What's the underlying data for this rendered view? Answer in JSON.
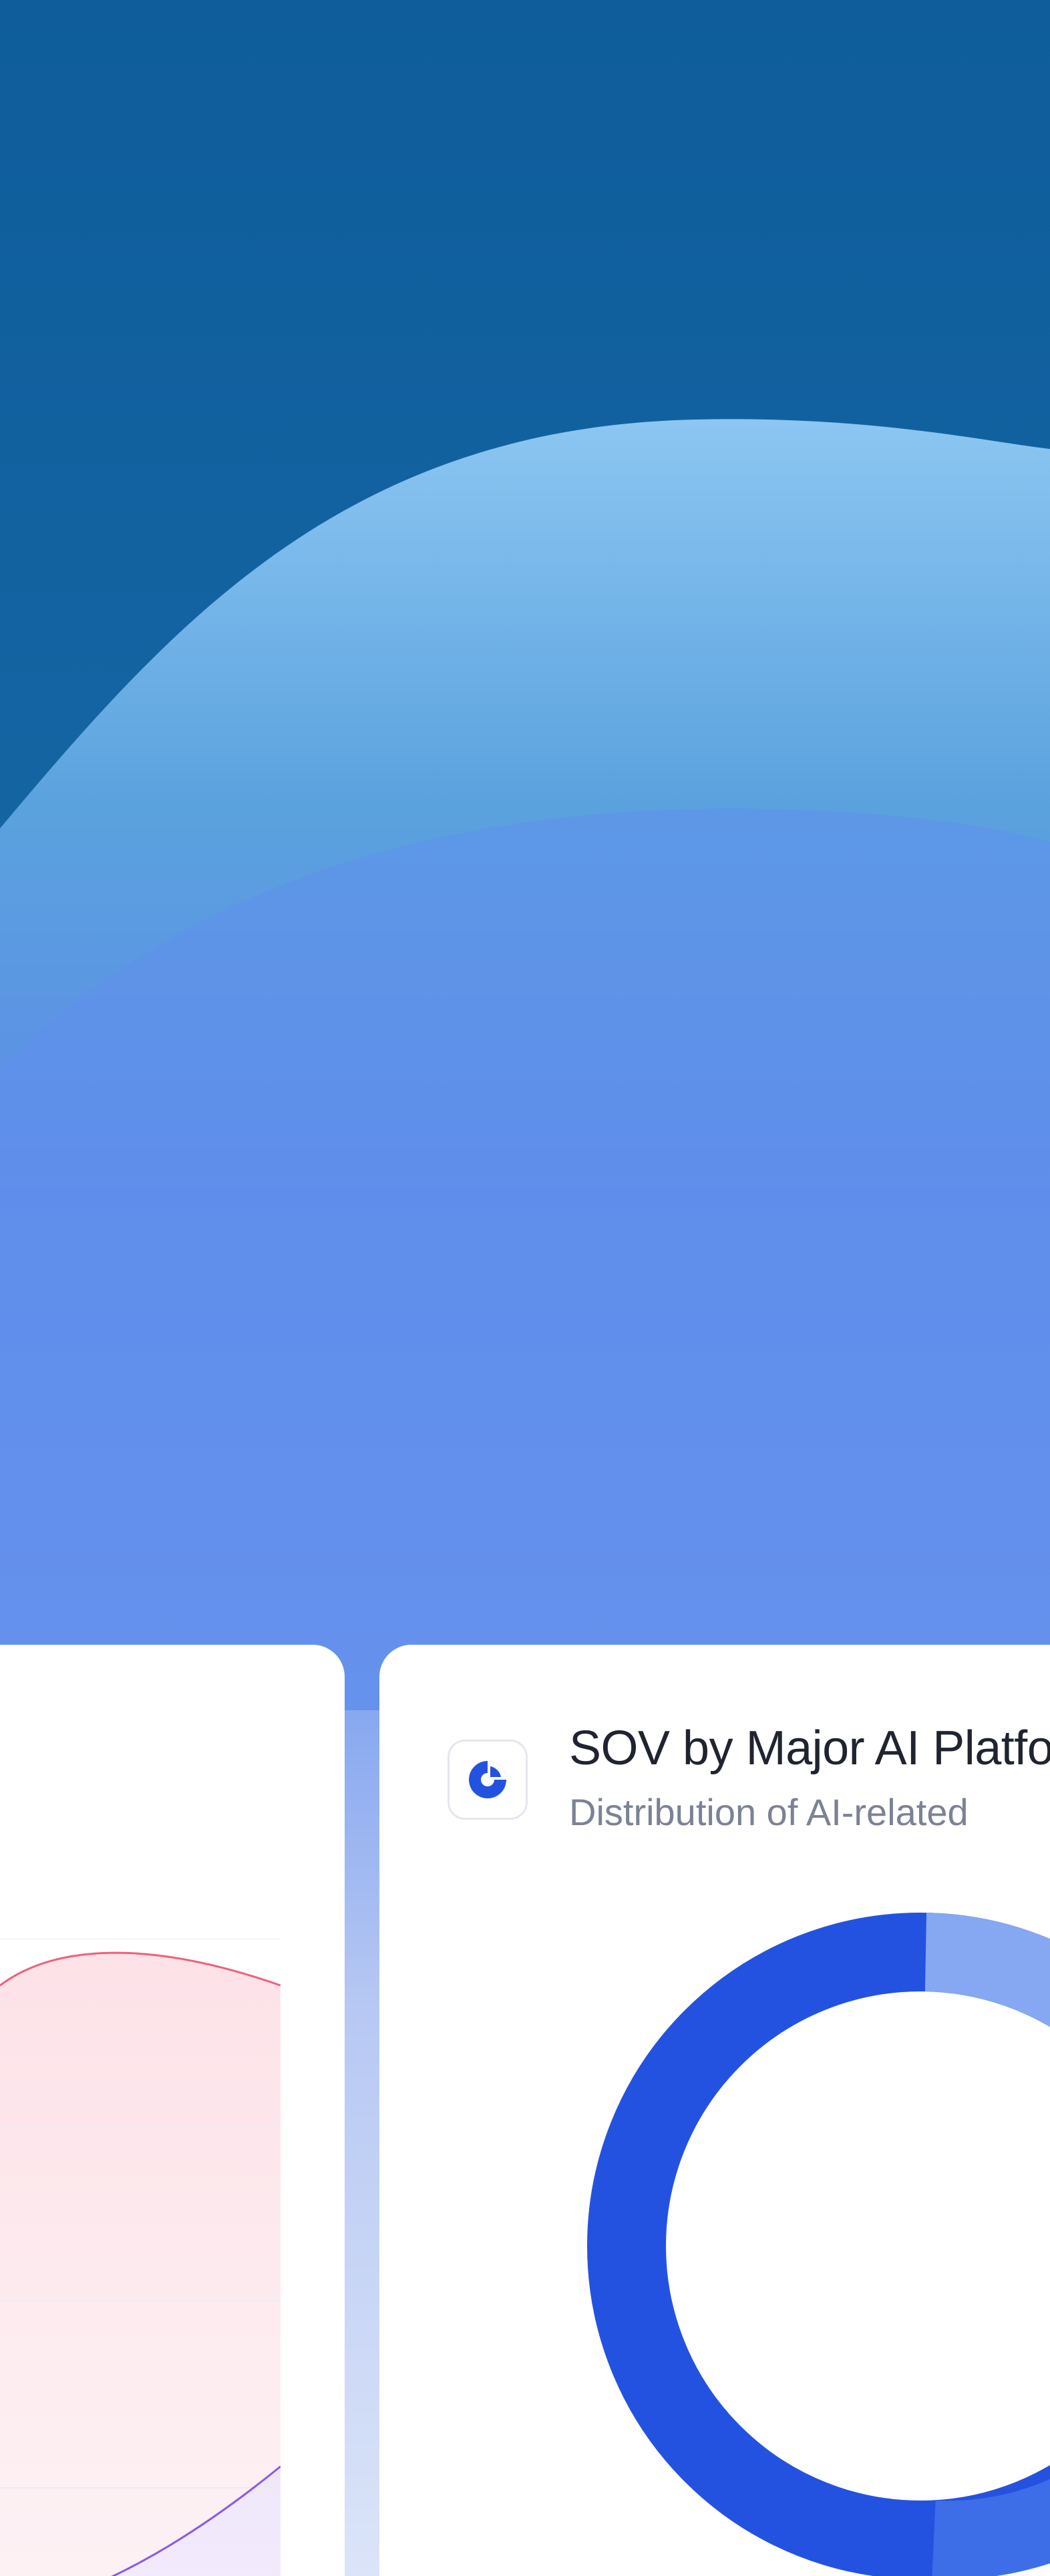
{
  "colors": {
    "background_top": "#12609c",
    "background_mid": "#5f8cea",
    "background_bottom": "#dbe4f8",
    "card": "#ffffff",
    "accent": "#2452e0"
  },
  "sov_card": {
    "icon": "pie-chart-icon",
    "title": "SOV by Major AI Platfo",
    "subtitle": "Distribution of AI-related"
  },
  "trend_card": {
    "line_colors": [
      "#f0607a",
      "#8a5ae6"
    ]
  }
}
